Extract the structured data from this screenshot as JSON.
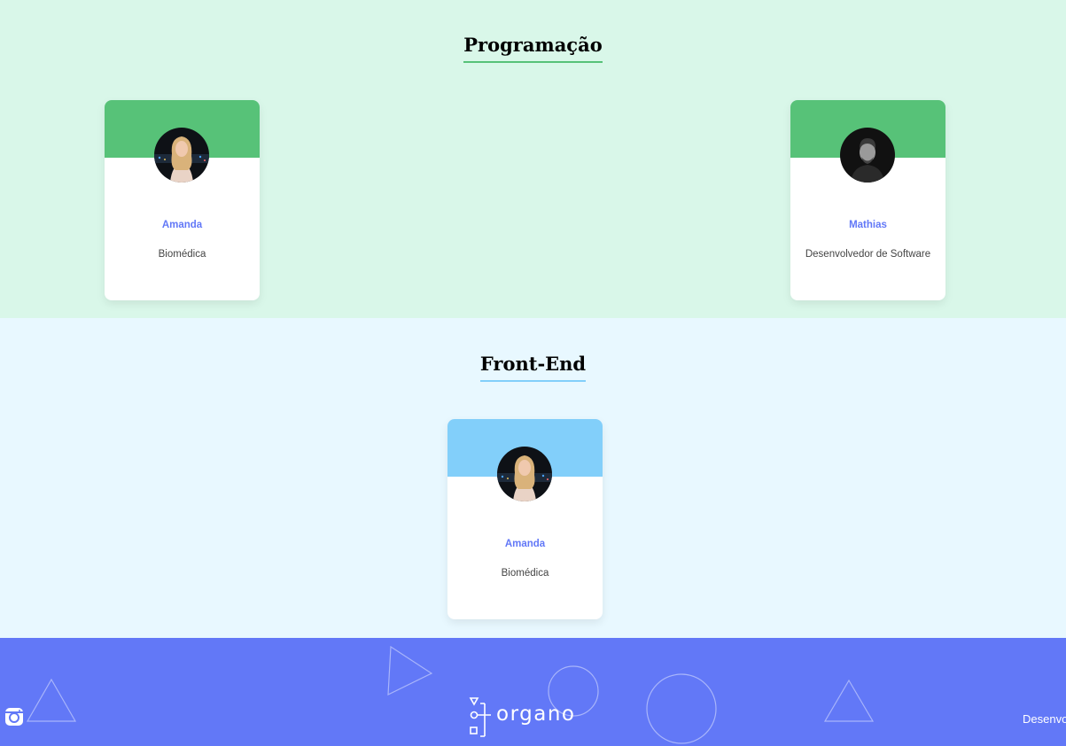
{
  "teams": [
    {
      "title": "Programação",
      "background": "#d9f7e9",
      "accent": "#57c278",
      "members": [
        {
          "name": "Amanda",
          "role": "Biomédica",
          "photo": "photo-woman-icon"
        },
        {
          "name": "Mathias",
          "role": "Desenvolvedor de Software",
          "photo": "photo-man-icon"
        }
      ]
    },
    {
      "title": "Front-End",
      "background": "#e8f8ff",
      "accent": "#82cffa",
      "members": [
        {
          "name": "Amanda",
          "role": "Biomédica",
          "photo": "photo-woman-icon"
        }
      ]
    }
  ],
  "footer": {
    "background": "#6278f7",
    "logo_text": "organo",
    "social_icon": "instagram-icon",
    "credit_text": "Desenvo"
  }
}
